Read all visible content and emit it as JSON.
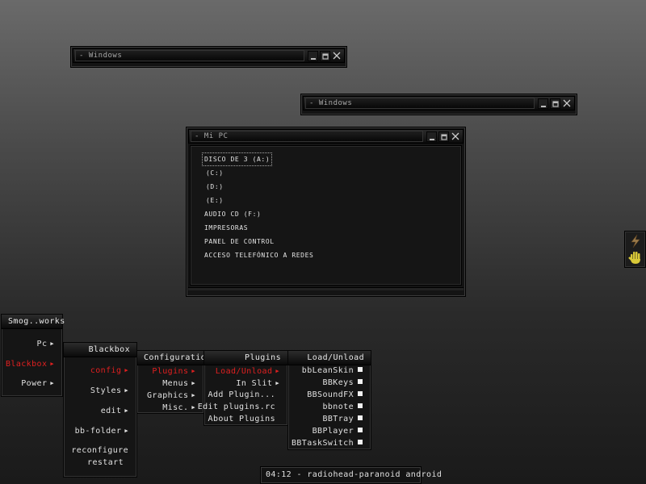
{
  "windows": [
    {
      "title": "- Windows"
    },
    {
      "title": "- Windows"
    }
  ],
  "mipc": {
    "title": "- Mi PC",
    "items": [
      {
        "label": "DISCO DE 3 (A:)"
      },
      {
        "label": "(C:)"
      },
      {
        "label": "(D:)"
      },
      {
        "label": "(E:)"
      },
      {
        "label": "AUDIO CD (F:)"
      },
      {
        "label": "IMPRESORAS"
      },
      {
        "label": "PANEL DE CONTROL"
      },
      {
        "label": "ACCESO TELEFÓNICO A REDES"
      }
    ]
  },
  "menus": {
    "root": {
      "title": "Smog..works",
      "items": [
        "Pc",
        "Blackbox",
        "Power"
      ]
    },
    "blackbox": {
      "title": "Blackbox",
      "items": [
        "config",
        "Styles",
        "edit",
        "bb-folder",
        "reconfigure",
        "restart"
      ]
    },
    "config": {
      "title": "Configuration",
      "items": [
        "Plugins",
        "Menus",
        "Graphics",
        "Misc."
      ]
    },
    "plugins": {
      "title": "Plugins",
      "items": [
        "Load/Unload",
        "In Slit",
        "Add Plugin...",
        "Edit plugins.rc",
        "About Plugins"
      ]
    },
    "loadunload": {
      "title": "Load/Unload",
      "items": [
        "bbLeanSkin",
        "BBKeys",
        "BBSoundFX",
        "bbnote",
        "BBTray",
        "BBPlayer",
        "BBTaskSwitch"
      ]
    }
  },
  "toolbar": {
    "clock": "04:12 - radiohead-paranoid android"
  },
  "colors": {
    "active": "#e02020",
    "text": "#e0e0e0",
    "frame": "#151515"
  },
  "icons": {
    "minimize": "minimize-icon",
    "maximize": "maximize-icon",
    "close": "close-icon",
    "slit1": "lightning-plugin-icon",
    "slit2": "hand-plugin-icon"
  }
}
